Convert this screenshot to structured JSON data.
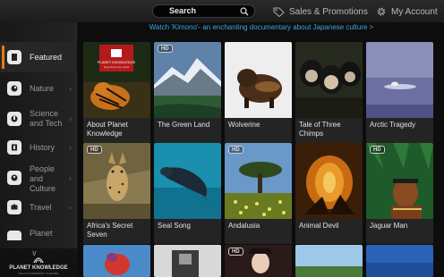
{
  "header": {
    "search_label": "Search",
    "sales_label": "Sales & Promotions",
    "account_label": "My Account"
  },
  "promo_text": "Watch 'Kimono'- an enchanting  documentary about Japanese culture  >",
  "sidebar": {
    "items": [
      {
        "label": "Featured",
        "active": true,
        "icon": "featured-icon"
      },
      {
        "label": "Nature",
        "active": false,
        "icon": "nature-icon"
      },
      {
        "label": "Science and Tech",
        "active": false,
        "icon": "science-icon"
      },
      {
        "label": "History",
        "active": false,
        "icon": "history-icon"
      },
      {
        "label": "People and Culture",
        "active": false,
        "icon": "people-icon"
      },
      {
        "label": "Travel",
        "active": false,
        "icon": "travel-icon"
      },
      {
        "label": "Planet",
        "active": false,
        "icon": "planet-icon"
      }
    ],
    "brand": {
      "name": "PLANET KNOWLEDGE",
      "tagline": "THE DOCUMENTARY CHANNEL"
    }
  },
  "tiles": [
    {
      "title": "About Planet Knowledge",
      "hd": false,
      "logo": "PLANET KNOWLEDGE",
      "logo_sub": "Experience the world"
    },
    {
      "title": "The Green Land",
      "hd": true,
      "badge": "HD"
    },
    {
      "title": "Wolverine",
      "hd": false
    },
    {
      "title": "Tale of Three Chimps",
      "hd": false
    },
    {
      "title": "Arctic Tragedy",
      "hd": false
    },
    {
      "title": "Africa's Secret Seven",
      "hd": true,
      "badge": "HD"
    },
    {
      "title": "Seal Song",
      "hd": false
    },
    {
      "title": "Andalusia",
      "hd": true,
      "badge": "HD"
    },
    {
      "title": "Animal Devil",
      "hd": false
    },
    {
      "title": "Jaguar Man",
      "hd": true,
      "badge": "HD"
    },
    {
      "title": "",
      "hd": false
    },
    {
      "title": "",
      "hd": false
    },
    {
      "title": "",
      "hd": true,
      "badge": "HD"
    },
    {
      "title": "",
      "hd": false
    },
    {
      "title": "",
      "hd": false
    }
  ]
}
